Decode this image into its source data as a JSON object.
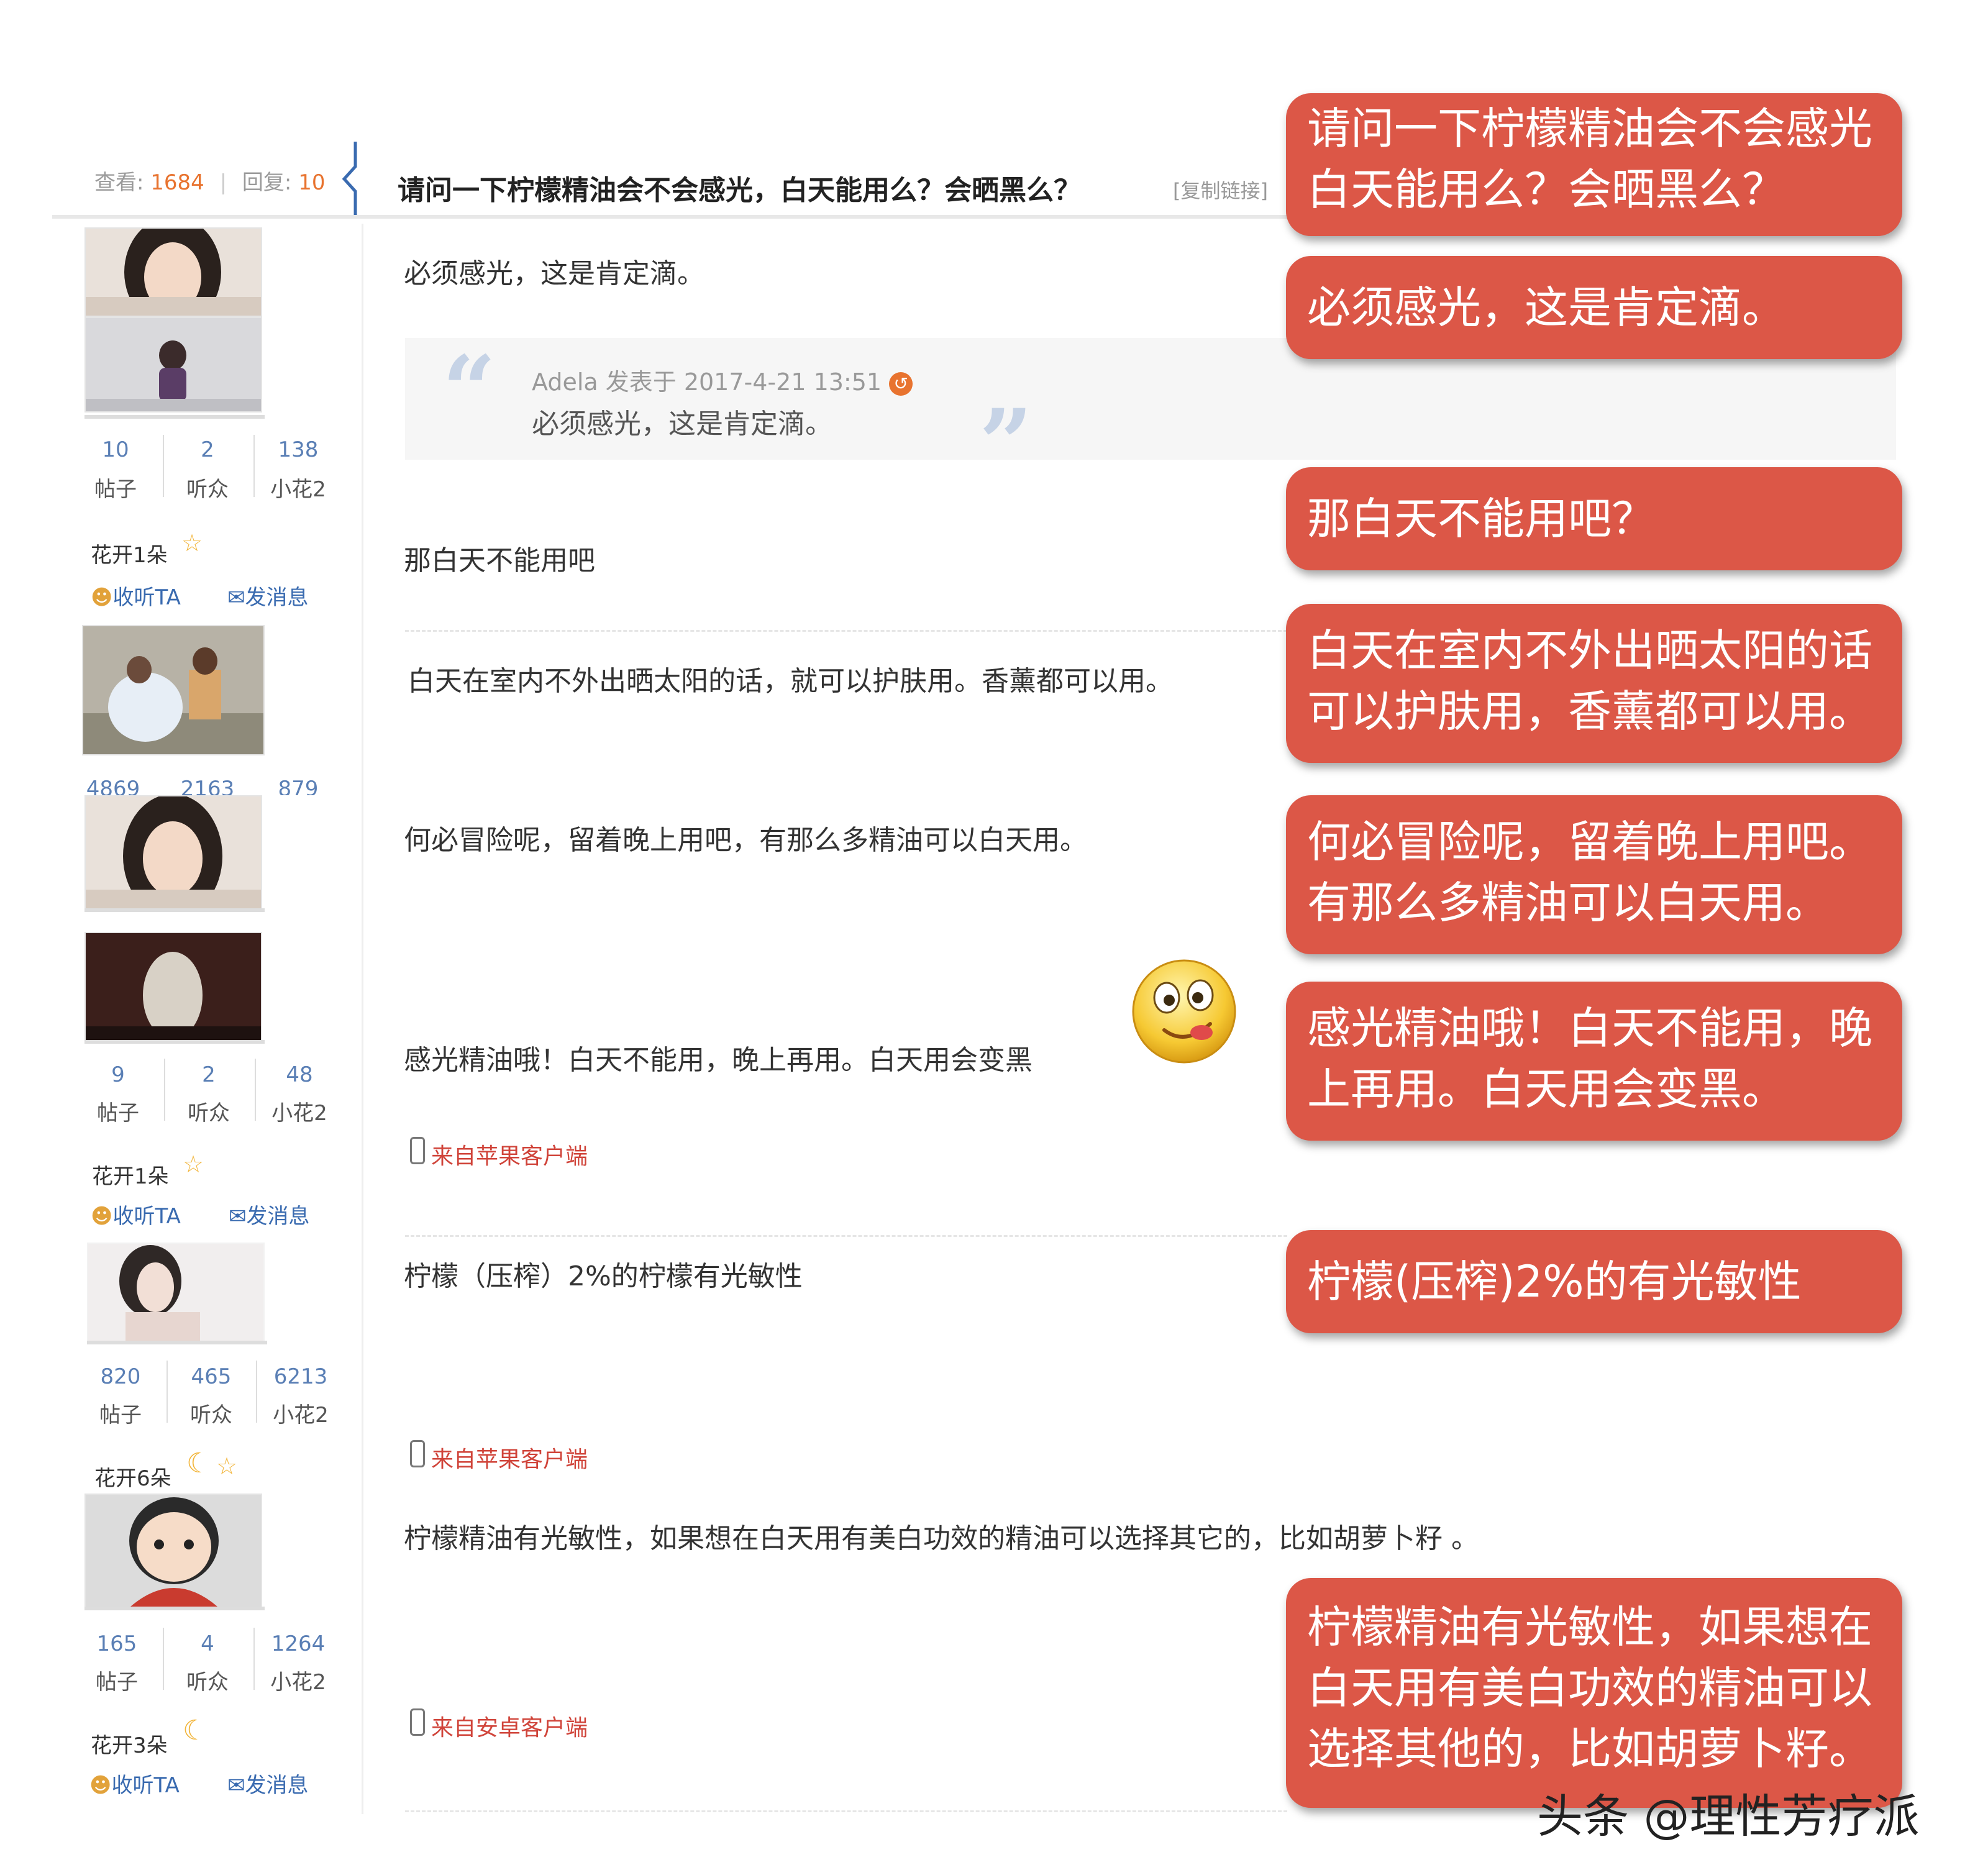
{
  "header": {
    "views_label": "查看:",
    "views": "1684",
    "replies_label": "回复:",
    "replies": "10",
    "title": "请问一下柠檬精油会不会感光，白天能用么？会晒黑么？",
    "copy_link": "[复制链接]"
  },
  "users": [
    {
      "posts": "10",
      "fans": "2",
      "flowers": "138",
      "posts_label": "帖子",
      "fans_label": "听众",
      "flowers_label": "小花2",
      "rank": "花开1朵",
      "follow": "收听TA",
      "message": "发消息"
    },
    {
      "posts": "4869",
      "fans": "2163",
      "flowers": "879"
    },
    {
      "posts": "9",
      "fans": "2",
      "flowers": "48",
      "posts_label": "帖子",
      "fans_label": "听众",
      "flowers_label": "小花2",
      "rank": "花开1朵",
      "follow": "收听TA",
      "message": "发消息"
    },
    {
      "posts": "820",
      "fans": "465",
      "flowers": "6213",
      "posts_label": "帖子",
      "fans_label": "听众",
      "flowers_label": "小花2",
      "rank": "花开6朵"
    },
    {
      "posts": "165",
      "fans": "4",
      "flowers": "1264",
      "posts_label": "帖子",
      "fans_label": "听众",
      "flowers_label": "小花2",
      "rank": "花开3朵",
      "follow": "收听TA",
      "message": "发消息"
    }
  ],
  "posts": {
    "p1": "必须感光，这是肯定滴。",
    "quote_meta": "Adela 发表于 2017-4-21 13:51",
    "quote_text": "必须感光，这是肯定滴。",
    "p2": "那白天不能用吧",
    "p3": "白天在室内不外出晒太阳的话，就可以护肤用。香薰都可以用。",
    "p4": "何必冒险呢，留着晚上用吧，有那么多精油可以白天用。",
    "p5": "感光精油哦！白天不能用，晚上再用。白天用会变黑",
    "p6": "柠檬（压榨）2%的柠檬有光敏性",
    "p7": "柠檬精油有光敏性，如果想在白天用有美白功效的精油可以选择其它的，比如胡萝卜籽 。",
    "client_apple": "来自苹果客户端",
    "client_android": "来自安卓客户端"
  },
  "callouts": {
    "c1_l1": "请问一下柠檬精油会不会感光",
    "c1_l2": "白天能用么？会晒黑么？",
    "c2": "必须感光，这是肯定滴。",
    "c3": "那白天不能用吧？",
    "c4_l1": "白天在室内不外出晒太阳的话",
    "c4_l2": "可以护肤用，香薰都可以用。",
    "c5_l1": "何必冒险呢，留着晚上用吧。",
    "c5_l2": "有那么多精油可以白天用。",
    "c6_l1": "感光精油哦！白天不能用，晚",
    "c6_l2": "上再用。白天用会变黑。",
    "c7": "柠檬(压榨)2%的有光敏性",
    "c8_l1": "柠檬精油有光敏性，如果想在",
    "c8_l2": "白天用有美白功效的精油可以",
    "c8_l3": "选择其他的，比如胡萝卜籽。"
  },
  "watermark": "头条 @理性芳疗派",
  "colors": {
    "callout": "#dc5747",
    "stat_number": "#5a7fb5",
    "link": "#3a6bb0",
    "highlight": "#e8732f",
    "client": "#d0443a"
  },
  "icons": [
    "quote-open-icon",
    "quote-close-icon",
    "back-arrow-icon",
    "star-icon",
    "moon-icon",
    "follow-icon",
    "mail-icon",
    "phone-icon",
    "emoji-tongue-icon"
  ]
}
